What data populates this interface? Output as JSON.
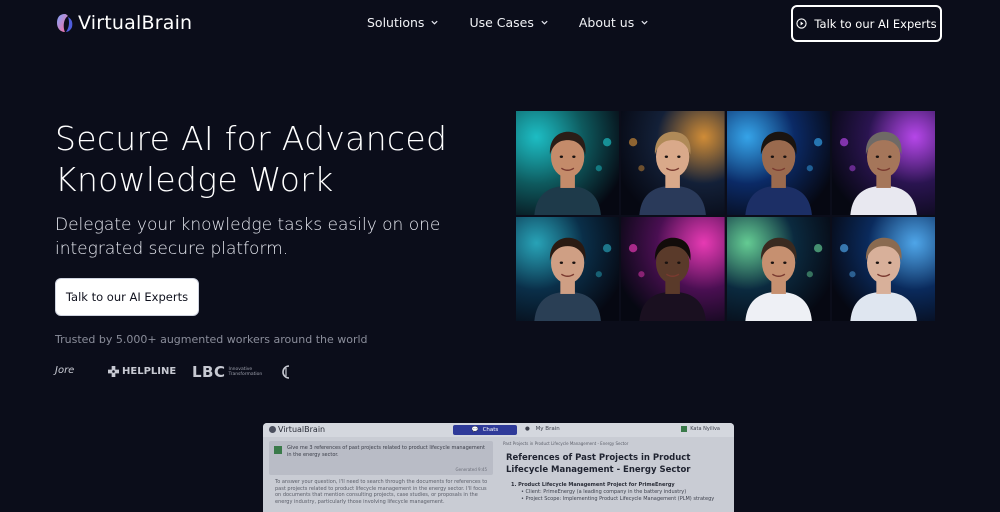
{
  "nav": {
    "logo_text": "VirtualBrain",
    "menu": [
      {
        "label": "Solutions"
      },
      {
        "label": "Use Cases"
      },
      {
        "label": "About us"
      }
    ],
    "cta_label": "Talk to our AI Experts"
  },
  "hero": {
    "title": "Secure AI for Advanced Knowledge Work",
    "subtitle": "Delegate your knowledge tasks easily on one integrated secure platform.",
    "cta_label": "Talk to our AI Experts",
    "trusted": "Trusted by 5.000+ augmented workers around the world"
  },
  "client_logos": {
    "jore": "Jore",
    "helpline": "HELPLINE",
    "lbc": "LBC",
    "lbc_tag_1": "Innovative",
    "lbc_tag_2": "Transformation"
  },
  "portraits": [
    {
      "name": "portrait-1",
      "bg": "#0e5a5e",
      "light": "#1fd0d6"
    },
    {
      "name": "portrait-2",
      "bg": "#132038",
      "light": "#e59a3a"
    },
    {
      "name": "portrait-3",
      "bg": "#0b2a66",
      "light": "#3ab4ff"
    },
    {
      "name": "portrait-4",
      "bg": "#2a1450",
      "light": "#c84dff"
    },
    {
      "name": "portrait-5",
      "bg": "#0a2f49",
      "light": "#2bb3c8"
    },
    {
      "name": "portrait-6",
      "bg": "#4a0f52",
      "light": "#ff3fc4"
    },
    {
      "name": "portrait-7",
      "bg": "#0b2a3f",
      "light": "#6ee0a0"
    },
    {
      "name": "portrait-8",
      "bg": "#0a2a5c",
      "light": "#56b6ff"
    }
  ],
  "preview": {
    "logo_text": "VirtualBrain",
    "tab_chats": "Chats",
    "tab_brain": "My Brain",
    "user_name": "Kata Nyiliva",
    "question": "Give me 3 references of past projects related to product lifecycle management in the energy sector.",
    "question_meta": "Generated 9:45",
    "answer": "To answer your question, I'll need to search through the documents for references to past projects related to product lifecycle management in the energy sector. I'll focus on documents that mention consulting projects, case studies, or proposals in the energy industry, particularly those involving lifecycle management.",
    "crumb": "Past Projects in Product Lifecycle Management - Energy Sector",
    "heading": "References of Past Projects in Product Lifecycle Management - Energy Sector",
    "list_item": "1. Product Lifecycle Management Project for PrimeEnergy",
    "list_sub_1": "• Client: PrimeEnergy (a leading company in the battery industry)",
    "list_sub_2": "• Project Scope: Implementing Product Lifecycle Management (PLM) strategy"
  },
  "colors": {
    "background": "#0b0d1a",
    "chats_tab": "#2f3a99"
  }
}
